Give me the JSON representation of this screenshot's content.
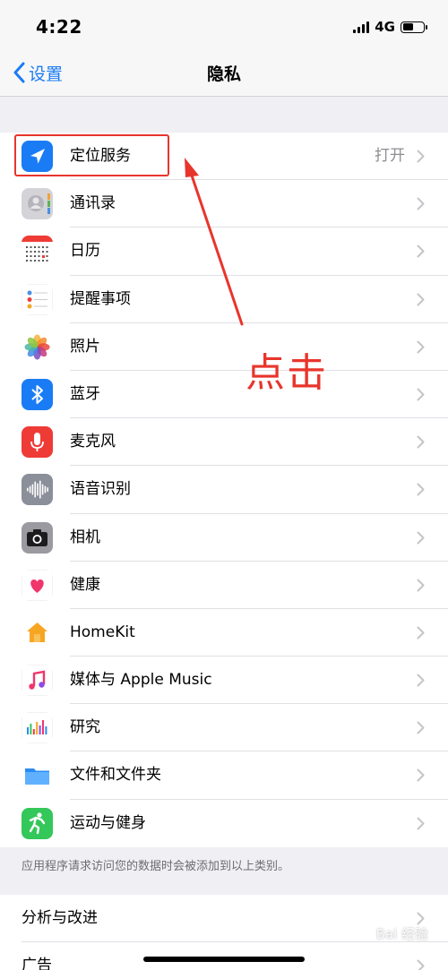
{
  "status_bar": {
    "time": "4:22",
    "network": "4G",
    "battery_level": 0.55
  },
  "nav": {
    "back_label": "设置",
    "title": "隐私"
  },
  "items": [
    {
      "label": "定位服务",
      "detail": "打开",
      "icon": "location-icon",
      "color": "#1a7cf5"
    },
    {
      "label": "通讯录",
      "detail": "",
      "icon": "contacts-icon",
      "color": "#c8c7cc"
    },
    {
      "label": "日历",
      "detail": "",
      "icon": "calendar-icon",
      "color": "#ffffff"
    },
    {
      "label": "提醒事项",
      "detail": "",
      "icon": "reminders-icon",
      "color": "#ffffff"
    },
    {
      "label": "照片",
      "detail": "",
      "icon": "photos-icon",
      "color": "#ffffff"
    },
    {
      "label": "蓝牙",
      "detail": "",
      "icon": "bluetooth-icon",
      "color": "#1a7cf5"
    },
    {
      "label": "麦克风",
      "detail": "",
      "icon": "microphone-icon",
      "color": "#ef3b36"
    },
    {
      "label": "语音识别",
      "detail": "",
      "icon": "speech-recognition-icon",
      "color": "#8a8f99"
    },
    {
      "label": "相机",
      "detail": "",
      "icon": "camera-icon",
      "color": "#8e8e93"
    },
    {
      "label": "健康",
      "detail": "",
      "icon": "health-icon",
      "color": "#ffffff"
    },
    {
      "label": "HomeKit",
      "detail": "",
      "icon": "homekit-icon",
      "color": "#ffffff"
    },
    {
      "label": "媒体与 Apple Music",
      "detail": "",
      "icon": "music-icon",
      "color": "#ffffff"
    },
    {
      "label": "研究",
      "detail": "",
      "icon": "research-icon",
      "color": "#ffffff"
    },
    {
      "label": "文件和文件夹",
      "detail": "",
      "icon": "files-icon",
      "color": "#ffffff"
    },
    {
      "label": "运动与健身",
      "detail": "",
      "icon": "fitness-icon",
      "color": "#34c759"
    }
  ],
  "footer_note": "应用程序请求访问您的数据时会被添加到以上类别。",
  "second_group": [
    {
      "label": "分析与改进"
    },
    {
      "label": "广告"
    }
  ],
  "annotation": {
    "text": "点击",
    "color": "#e8352c"
  },
  "watermark": "Bai 经验"
}
